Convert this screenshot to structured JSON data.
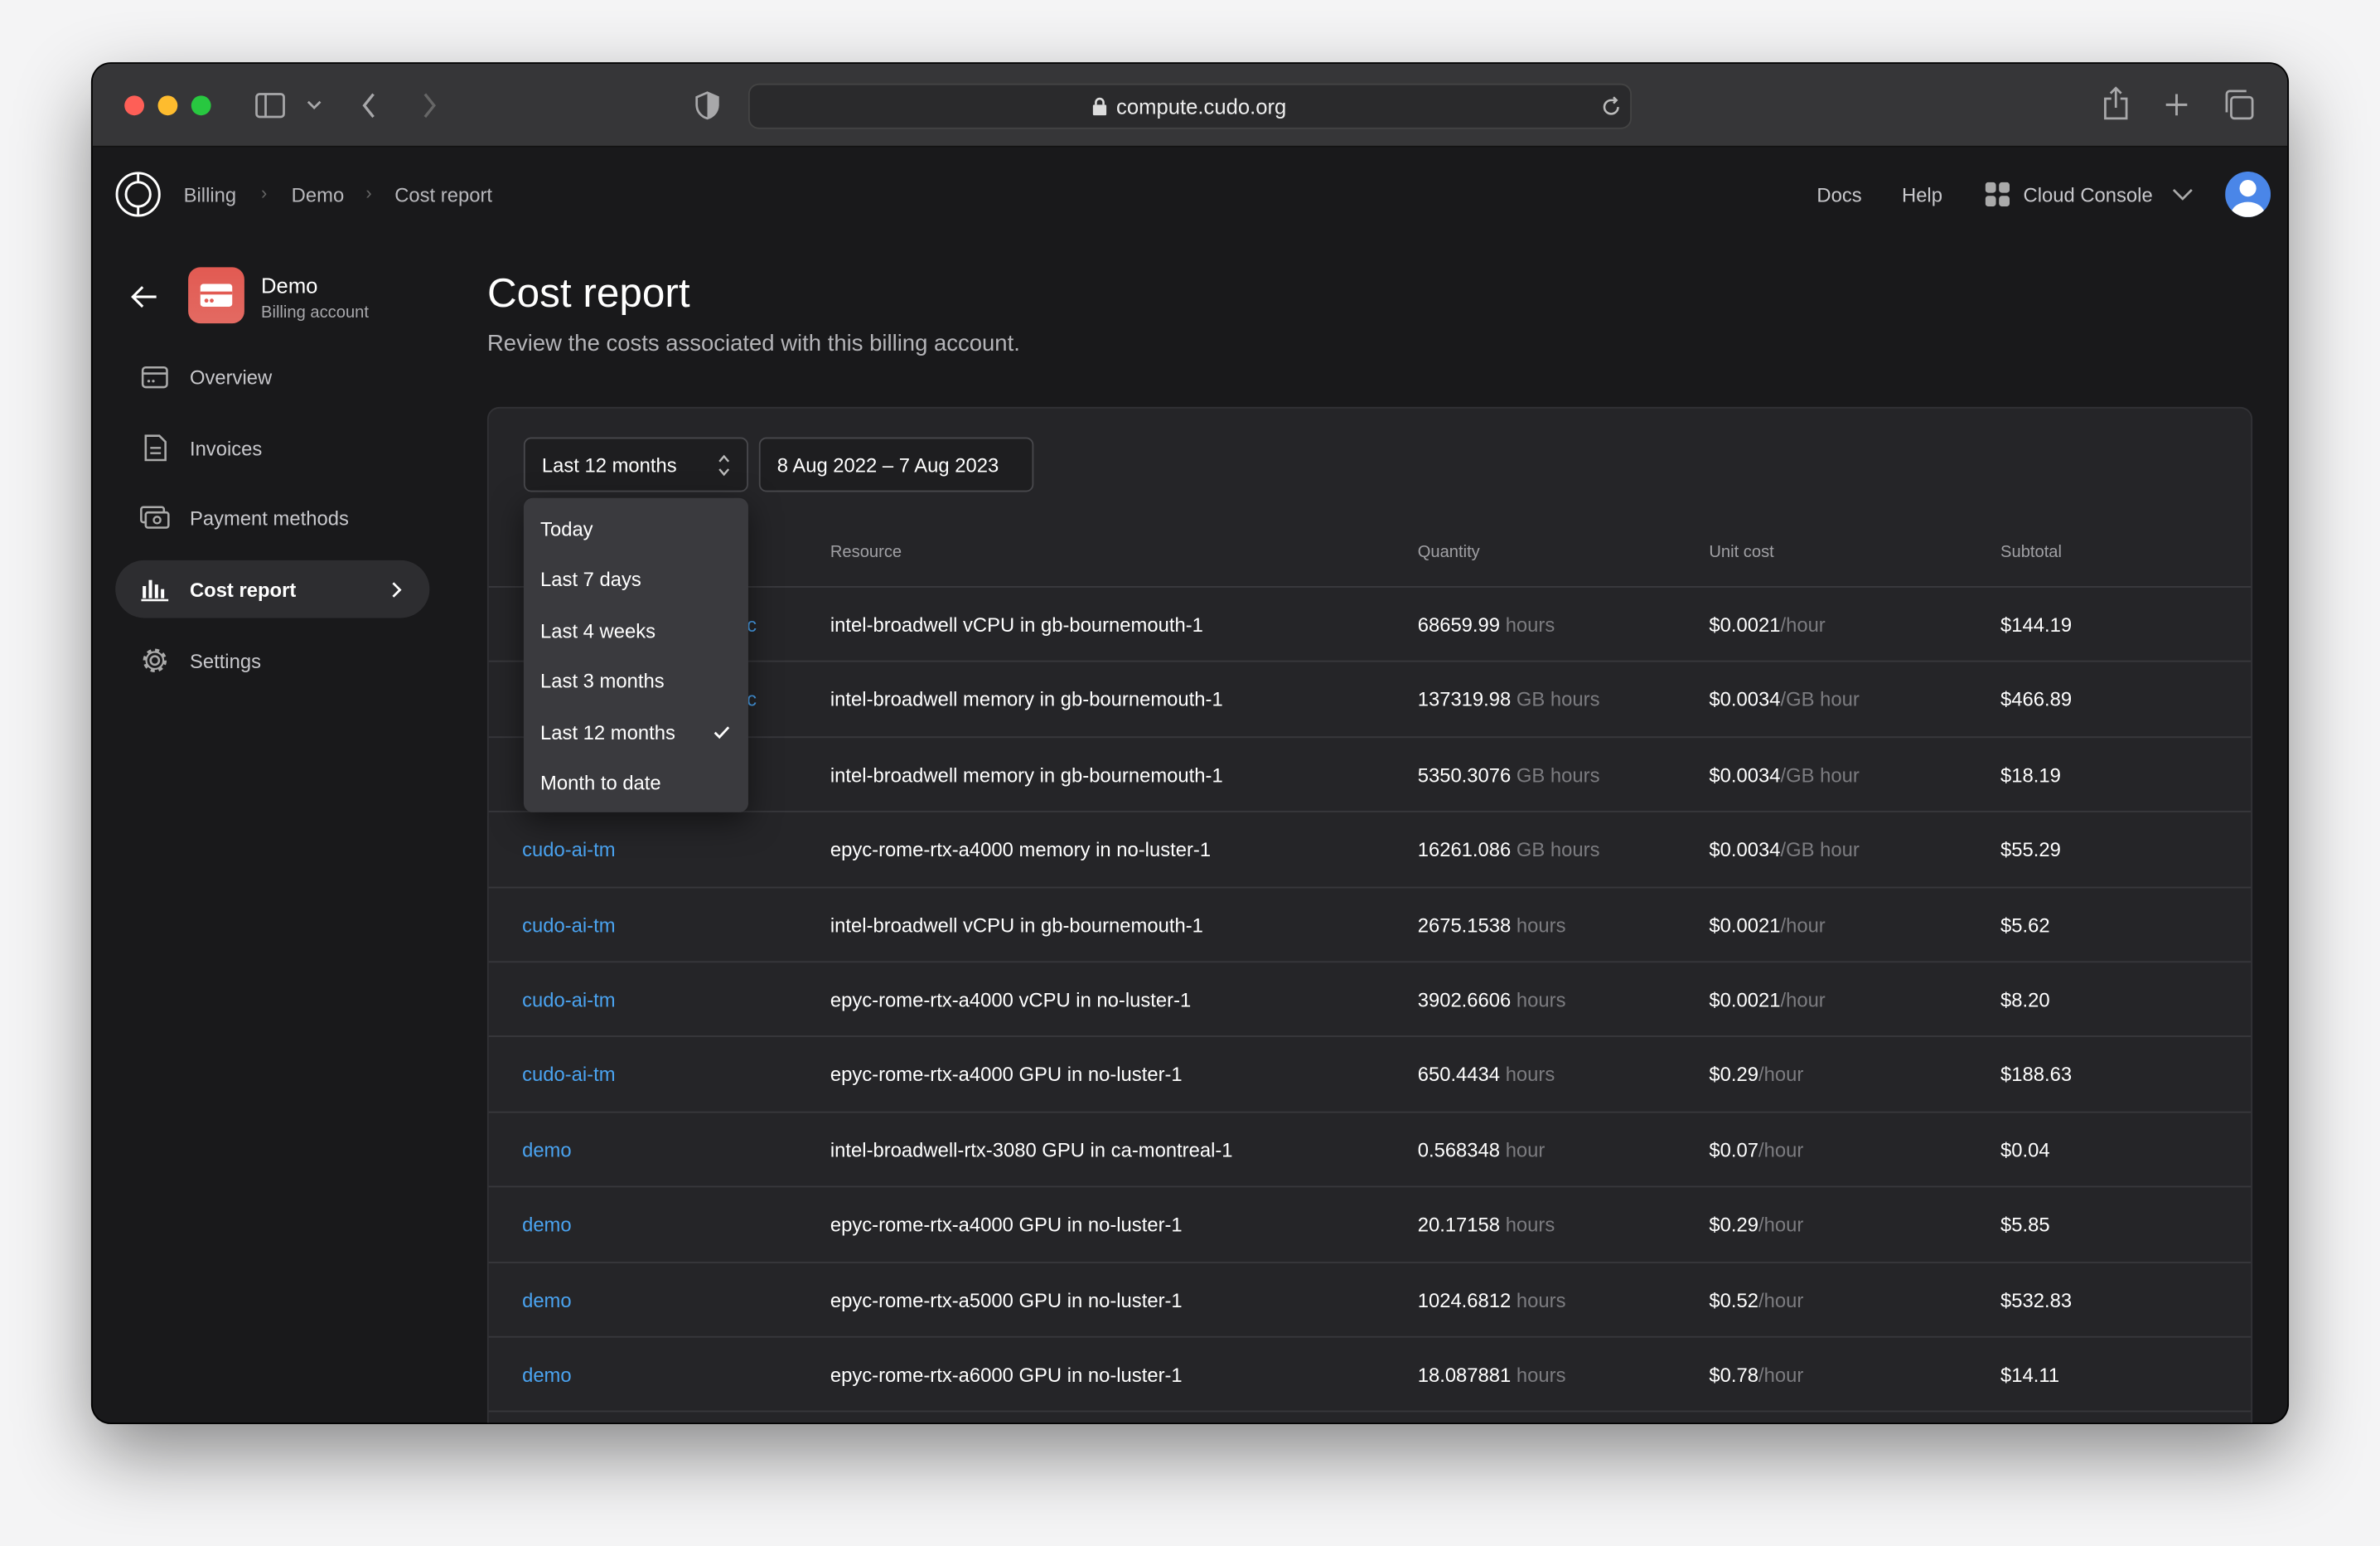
{
  "browser": {
    "url": "compute.cudo.org"
  },
  "breadcrumb": [
    "Billing",
    "Demo",
    "Cost report"
  ],
  "header": {
    "docs": "Docs",
    "help": "Help",
    "console": "Cloud Console"
  },
  "account": {
    "name": "Demo",
    "type": "Billing account",
    "icon_color": "#e5534b"
  },
  "sidebar": {
    "items": [
      {
        "label": "Overview",
        "icon": "card-icon"
      },
      {
        "label": "Invoices",
        "icon": "document-icon"
      },
      {
        "label": "Payment methods",
        "icon": "payment-icon"
      },
      {
        "label": "Cost report",
        "icon": "bar-chart-icon",
        "active": true
      },
      {
        "label": "Settings",
        "icon": "gear-icon"
      }
    ]
  },
  "page": {
    "title": "Cost report",
    "subtitle": "Review the costs associated with this billing account."
  },
  "filters": {
    "range": "Last 12 months",
    "dates": "8 Aug 2022 – 7 Aug 2023",
    "options": [
      "Today",
      "Last 7 days",
      "Last 4 weeks",
      "Last 3 months",
      "Last 12 months",
      "Month to date"
    ],
    "selected": "Last 12 months"
  },
  "table": {
    "columns": [
      "Resource",
      "Quantity",
      "Unit cost",
      "Subtotal"
    ],
    "rows": [
      {
        "account": "c",
        "resource": "intel-broadwell vCPU in gb-bournemouth-1",
        "qty": "68659.99",
        "qty_unit": "hours",
        "cost": "$0.0021",
        "cost_unit": "/hour",
        "subtotal": "$144.19"
      },
      {
        "account": "c",
        "resource": "intel-broadwell memory in gb-bournemouth-1",
        "qty": "137319.98",
        "qty_unit": "GB hours",
        "cost": "$0.0034",
        "cost_unit": "/GB hour",
        "subtotal": "$466.89"
      },
      {
        "account": "",
        "resource": "intel-broadwell memory in gb-bournemouth-1",
        "qty": "5350.3076",
        "qty_unit": "GB hours",
        "cost": "$0.0034",
        "cost_unit": "/GB hour",
        "subtotal": "$18.19"
      },
      {
        "account": "cudo-ai-tm",
        "resource": "epyc-rome-rtx-a4000 memory in no-luster-1",
        "qty": "16261.086",
        "qty_unit": "GB hours",
        "cost": "$0.0034",
        "cost_unit": "/GB hour",
        "subtotal": "$55.29"
      },
      {
        "account": "cudo-ai-tm",
        "resource": "intel-broadwell vCPU in gb-bournemouth-1",
        "qty": "2675.1538",
        "qty_unit": "hours",
        "cost": "$0.0021",
        "cost_unit": "/hour",
        "subtotal": "$5.62"
      },
      {
        "account": "cudo-ai-tm",
        "resource": "epyc-rome-rtx-a4000 vCPU in no-luster-1",
        "qty": "3902.6606",
        "qty_unit": "hours",
        "cost": "$0.0021",
        "cost_unit": "/hour",
        "subtotal": "$8.20"
      },
      {
        "account": "cudo-ai-tm",
        "resource": "epyc-rome-rtx-a4000 GPU in no-luster-1",
        "qty": "650.4434",
        "qty_unit": "hours",
        "cost": "$0.29",
        "cost_unit": "/hour",
        "subtotal": "$188.63"
      },
      {
        "account": "demo",
        "resource": "intel-broadwell-rtx-3080 GPU in ca-montreal-1",
        "qty": "0.568348",
        "qty_unit": "hour",
        "cost": "$0.07",
        "cost_unit": "/hour",
        "subtotal": "$0.04"
      },
      {
        "account": "demo",
        "resource": "epyc-rome-rtx-a4000 GPU in no-luster-1",
        "qty": "20.17158",
        "qty_unit": "hours",
        "cost": "$0.29",
        "cost_unit": "/hour",
        "subtotal": "$5.85"
      },
      {
        "account": "demo",
        "resource": "epyc-rome-rtx-a5000 GPU in no-luster-1",
        "qty": "1024.6812",
        "qty_unit": "hours",
        "cost": "$0.52",
        "cost_unit": "/hour",
        "subtotal": "$532.83"
      },
      {
        "account": "demo",
        "resource": "epyc-rome-rtx-a6000 GPU in no-luster-1",
        "qty": "18.087881",
        "qty_unit": "hours",
        "cost": "$0.78",
        "cost_unit": "/hour",
        "subtotal": "$14.11"
      }
    ]
  },
  "colors": {
    "link": "#4aa3f0",
    "background": "#19191b",
    "card": "#252528"
  }
}
